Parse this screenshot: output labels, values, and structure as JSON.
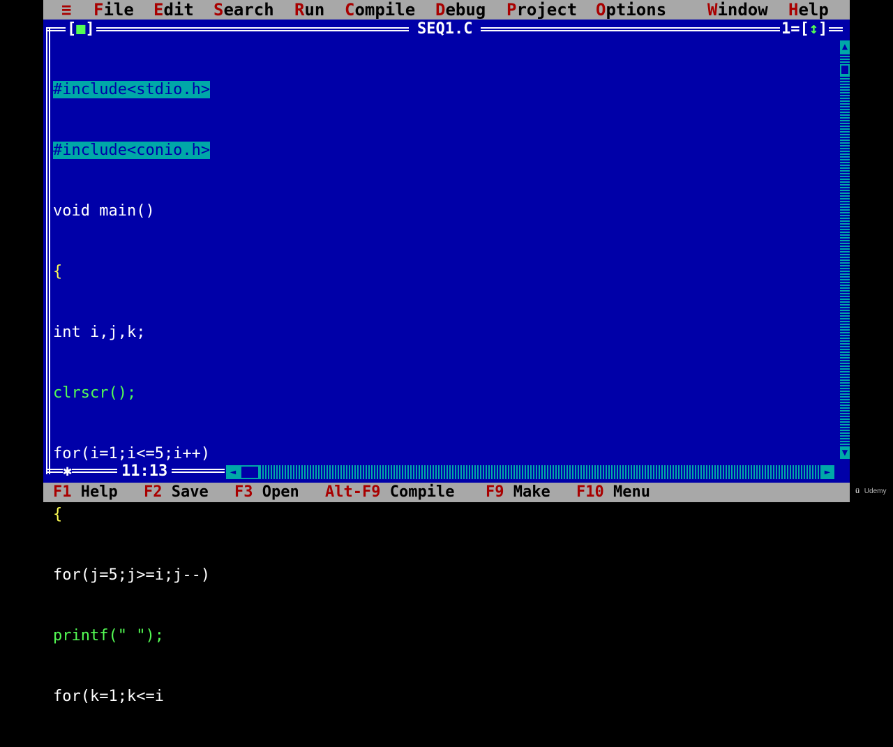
{
  "menubar": {
    "system_icon": "≡",
    "items": [
      {
        "hot": "F",
        "rest": "ile"
      },
      {
        "hot": "E",
        "rest": "dit"
      },
      {
        "hot": "S",
        "rest": "earch"
      },
      {
        "hot": "R",
        "rest": "un"
      },
      {
        "hot": "C",
        "rest": "ompile"
      },
      {
        "hot": "D",
        "rest": "ebug"
      },
      {
        "hot": "P",
        "rest": "roject"
      },
      {
        "hot": "O",
        "rest": "ptions"
      },
      {
        "hot": "W",
        "rest": "indow"
      },
      {
        "hot": "H",
        "rest": "elp"
      }
    ]
  },
  "window": {
    "close_box_left": "[",
    "close_box_mark": "■",
    "close_box_right": "]",
    "title": "SEQ1.C",
    "number": "1=[",
    "zoom_arrow": "↕",
    "number_close": "]"
  },
  "editor": {
    "lines": [
      "#include<stdio.h>",
      "#include<conio.h>",
      "void main()",
      "{",
      "int i,j,k;",
      "clrscr();",
      "for(i=1;i<=5;i++)",
      "{",
      "for(j=5;j>=i;j--)",
      "printf(\" \");",
      "for(k=1;k<=i"
    ]
  },
  "status": {
    "cursor_position": "11:13",
    "modified_marker": "✱"
  },
  "scrollbars": {
    "up_arrow": "▲",
    "down_arrow": "▼",
    "left_arrow": "◄",
    "right_arrow": "►"
  },
  "fkeys": [
    {
      "key": "F1",
      "label": "Help"
    },
    {
      "key": "F2",
      "label": "Save"
    },
    {
      "key": "F3",
      "label": "Open"
    },
    {
      "key": "Alt-F9",
      "label": "Compile"
    },
    {
      "key": "F9",
      "label": "Make"
    },
    {
      "key": "F10",
      "label": "Menu"
    }
  ],
  "watermark": {
    "logo": "ü",
    "text": "Udemy"
  },
  "colors": {
    "editor_bg": "#0000A8",
    "menu_bg": "#A8A8A8",
    "hotkey": "#A80000",
    "selection": "#00A8A8",
    "code_text": "#FFFF54"
  }
}
